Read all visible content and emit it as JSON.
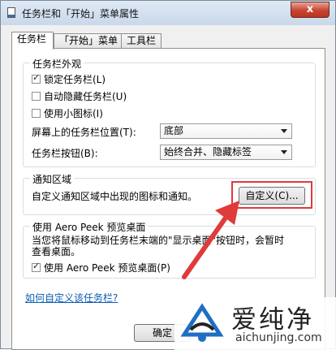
{
  "window": {
    "title": "任务栏和「开始」菜单属性",
    "close_label": "x"
  },
  "tabs": [
    {
      "label": "任务栏",
      "active": true
    },
    {
      "label": "「开始」菜单",
      "active": false
    },
    {
      "label": "工具栏",
      "active": false
    }
  ],
  "appearance": {
    "group_title": "任务栏外观",
    "lock_taskbar": {
      "label": "锁定任务栏(L)",
      "checked": true
    },
    "auto_hide": {
      "label": "自动隐藏任务栏(U)",
      "checked": false
    },
    "small_icons": {
      "label": "使用小图标(I)",
      "checked": false
    },
    "location_label": "屏幕上的任务栏位置(T):",
    "location_value": "底部",
    "buttons_label": "任务栏按钮(B):",
    "buttons_value": "始终合并、隐藏标签"
  },
  "notification": {
    "group_title": "通知区域",
    "description": "自定义通知区域中出现的图标和通知。",
    "customize_button": "自定义(C)..."
  },
  "aero_peek": {
    "group_title": "使用 Aero Peek 预览桌面",
    "description_line1": "当您将鼠标移动到任务栏末端的\"显示桌面\"按钮时，会暂时",
    "description_line2": "查看桌面。",
    "checkbox": {
      "label": "使用 Aero Peek 预览桌面(P)",
      "checked": true
    }
  },
  "help_link": "如何自定义该任务栏?",
  "ok_button": "确定",
  "watermark": {
    "text_cn": "爱纯净",
    "text_en": "aichunjing.com"
  },
  "colors": {
    "highlight": "#e03a3a",
    "link": "#0b5db3"
  }
}
